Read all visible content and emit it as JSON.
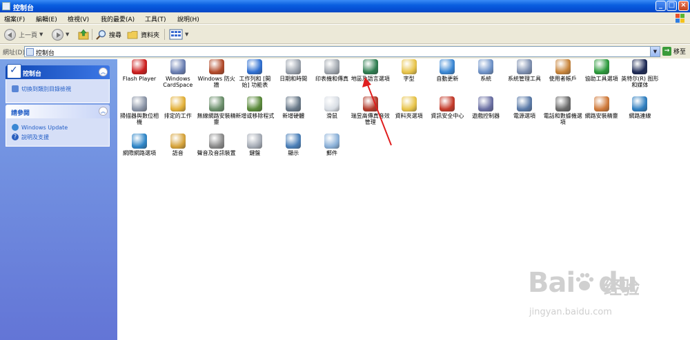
{
  "window": {
    "title": "控制台"
  },
  "menubar": [
    "檔案(F)",
    "編輯(E)",
    "檢視(V)",
    "我的最愛(A)",
    "工具(T)",
    "說明(H)"
  ],
  "toolbar": {
    "back_label": "上一頁",
    "search_label": "搜尋",
    "folders_label": "資料夾"
  },
  "address": {
    "label": "網址(D)",
    "value": "控制台",
    "go_label": "移至"
  },
  "sidebar": {
    "control_panel_title": "控制台",
    "switch_link": "切換到類別目錄檢視",
    "see_also_title": "請參閱",
    "see_also_links": [
      "Windows Update",
      "說明及支援"
    ]
  },
  "items": [
    {
      "label": "Flash Player",
      "icon": "flash-icon",
      "color": "#cc1e1e"
    },
    {
      "label": "Windows CardSpace",
      "icon": "cardspace-icon",
      "color": "#6a7fb3"
    },
    {
      "label": "Windows 防火牆",
      "icon": "firewall-icon",
      "color": "#b24a2a"
    },
    {
      "label": "工作列和 [開始] 功能表",
      "icon": "taskbar-icon",
      "color": "#2f6fd1"
    },
    {
      "label": "日期和時間",
      "icon": "clock-icon",
      "color": "#9aa2ad"
    },
    {
      "label": "印表機和傳真",
      "icon": "printer-icon",
      "color": "#a0a6ae"
    },
    {
      "label": "地區及語言選項",
      "icon": "globe-icon",
      "color": "#2e7d50"
    },
    {
      "label": "字型",
      "icon": "fonts-folder-icon",
      "color": "#e8c44a"
    },
    {
      "label": "自動更新",
      "icon": "windows-update-icon",
      "color": "#3a87d4"
    },
    {
      "label": "系統",
      "icon": "system-icon",
      "color": "#6f93c9"
    },
    {
      "label": "系統管理工具",
      "icon": "admin-tools-icon",
      "color": "#7d8fb0"
    },
    {
      "label": "使用者帳戶",
      "icon": "users-icon",
      "color": "#c8843a"
    },
    {
      "label": "協助工具選項",
      "icon": "accessibility-icon",
      "color": "#2b9a3b"
    },
    {
      "label": "英特尔(R) 图形和媒体",
      "icon": "intel-graphics-icon",
      "color": "#1e2a55"
    },
    {
      "label": "掃描器與數位相機",
      "icon": "scanner-icon",
      "color": "#8a94a6"
    },
    {
      "label": "排定的工作",
      "icon": "scheduled-tasks-icon",
      "color": "#e3b13a"
    },
    {
      "label": "無線網路安裝精靈",
      "icon": "wireless-icon",
      "color": "#6b8f6b"
    },
    {
      "label": "新增或移除程式",
      "icon": "add-remove-icon",
      "color": "#5a8a3a"
    },
    {
      "label": "新增硬體",
      "icon": "add-hardware-icon",
      "color": "#6a7a8a"
    },
    {
      "label": "滑鼠",
      "icon": "mouse-icon",
      "color": "#d8dde4"
    },
    {
      "label": "瑞昱高傳真音效管理",
      "icon": "realtek-audio-icon",
      "color": "#b23a2a"
    },
    {
      "label": "資料夾選項",
      "icon": "folder-options-icon",
      "color": "#e8c44a"
    },
    {
      "label": "資訊安全中心",
      "icon": "security-center-icon",
      "color": "#c43a2a"
    },
    {
      "label": "遊戲控制器",
      "icon": "game-controller-icon",
      "color": "#6a6fa3"
    },
    {
      "label": "電源選項",
      "icon": "power-icon",
      "color": "#5a7aa8"
    },
    {
      "label": "電話和數據機選項",
      "icon": "phone-modem-icon",
      "color": "#6b6b6b"
    },
    {
      "label": "網路安裝精靈",
      "icon": "network-setup-icon",
      "color": "#d07a3a"
    },
    {
      "label": "網路連線",
      "icon": "network-connections-icon",
      "color": "#2f7fc0"
    },
    {
      "label": "網際網路選項",
      "icon": "internet-options-icon",
      "color": "#2f86c8"
    },
    {
      "label": "語音",
      "icon": "speech-icon",
      "color": "#d6a33a"
    },
    {
      "label": "聲音及音訊裝置",
      "icon": "sound-icon",
      "color": "#8a8a8a"
    },
    {
      "label": "鍵盤",
      "icon": "keyboard-icon",
      "color": "#a6acb6"
    },
    {
      "label": "顯示",
      "icon": "display-icon",
      "color": "#4a7fb8"
    },
    {
      "label": "郵件",
      "icon": "mail-icon",
      "color": "#8ab0d8"
    }
  ],
  "watermark": {
    "brand": "Bai",
    "brand2": "du",
    "cn": "经验",
    "url": "jingyan.baidu.com"
  }
}
